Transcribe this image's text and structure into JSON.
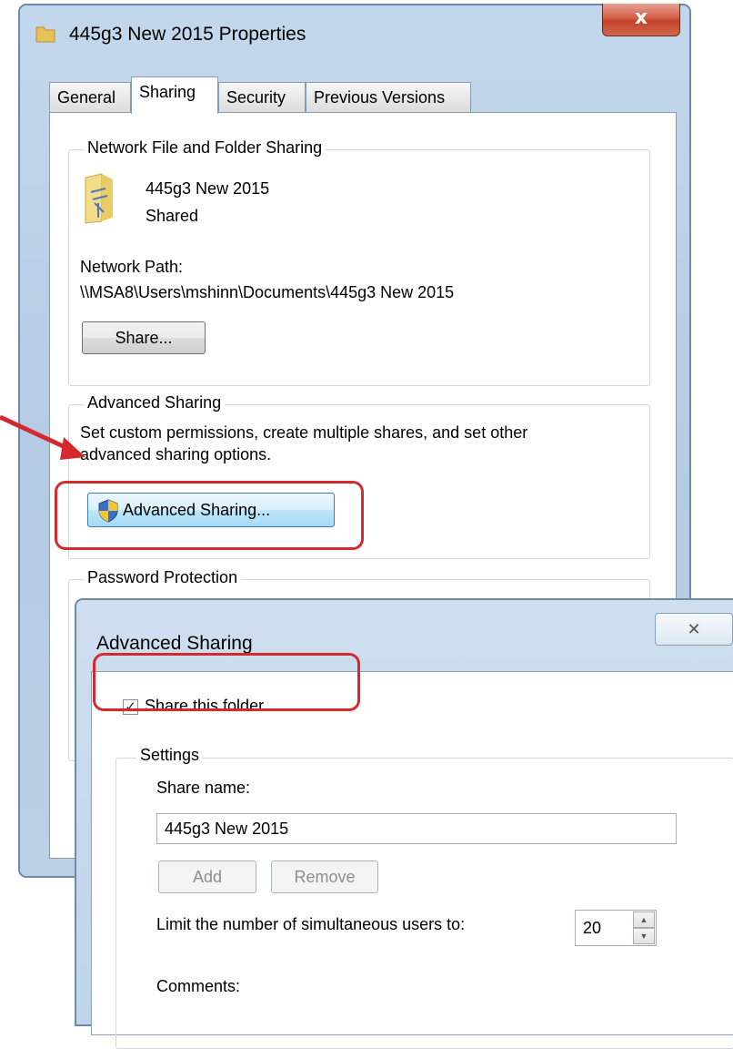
{
  "properties_window": {
    "title": "445g3 New 2015 Properties",
    "close_glyph": "x",
    "tabs": [
      {
        "label": "General",
        "active": false
      },
      {
        "label": "Sharing",
        "active": true
      },
      {
        "label": "Security",
        "active": false
      },
      {
        "label": "Previous Versions",
        "active": false
      }
    ],
    "network_sharing": {
      "legend": "Network File and Folder Sharing",
      "item_name": "445g3 New 2015",
      "item_status": "Shared",
      "path_label": "Network Path:",
      "path_value": "\\\\MSA8\\Users\\mshinn\\Documents\\445g3 New 2015",
      "share_button": "Share..."
    },
    "advanced_sharing": {
      "legend": "Advanced Sharing",
      "description_line1": "Set custom permissions, create multiple shares, and set other",
      "description_line2": "advanced sharing options.",
      "button": "Advanced Sharing..."
    },
    "password_protection": {
      "legend": "Password Protection"
    }
  },
  "advanced_dialog": {
    "title": "Advanced Sharing",
    "close_glyph": "✕",
    "share_checkbox_label": "Share this folder",
    "share_checked": true,
    "settings_legend": "Settings",
    "share_name_label": "Share name:",
    "share_name_value": "445g3 New 2015",
    "add_button": "Add",
    "remove_button": "Remove",
    "limit_label": "Limit the number of simultaneous users to:",
    "limit_value": "20",
    "comments_label": "Comments:"
  },
  "colors": {
    "highlight_red": "#d4292f",
    "window_frame": "#b4cbe4"
  }
}
